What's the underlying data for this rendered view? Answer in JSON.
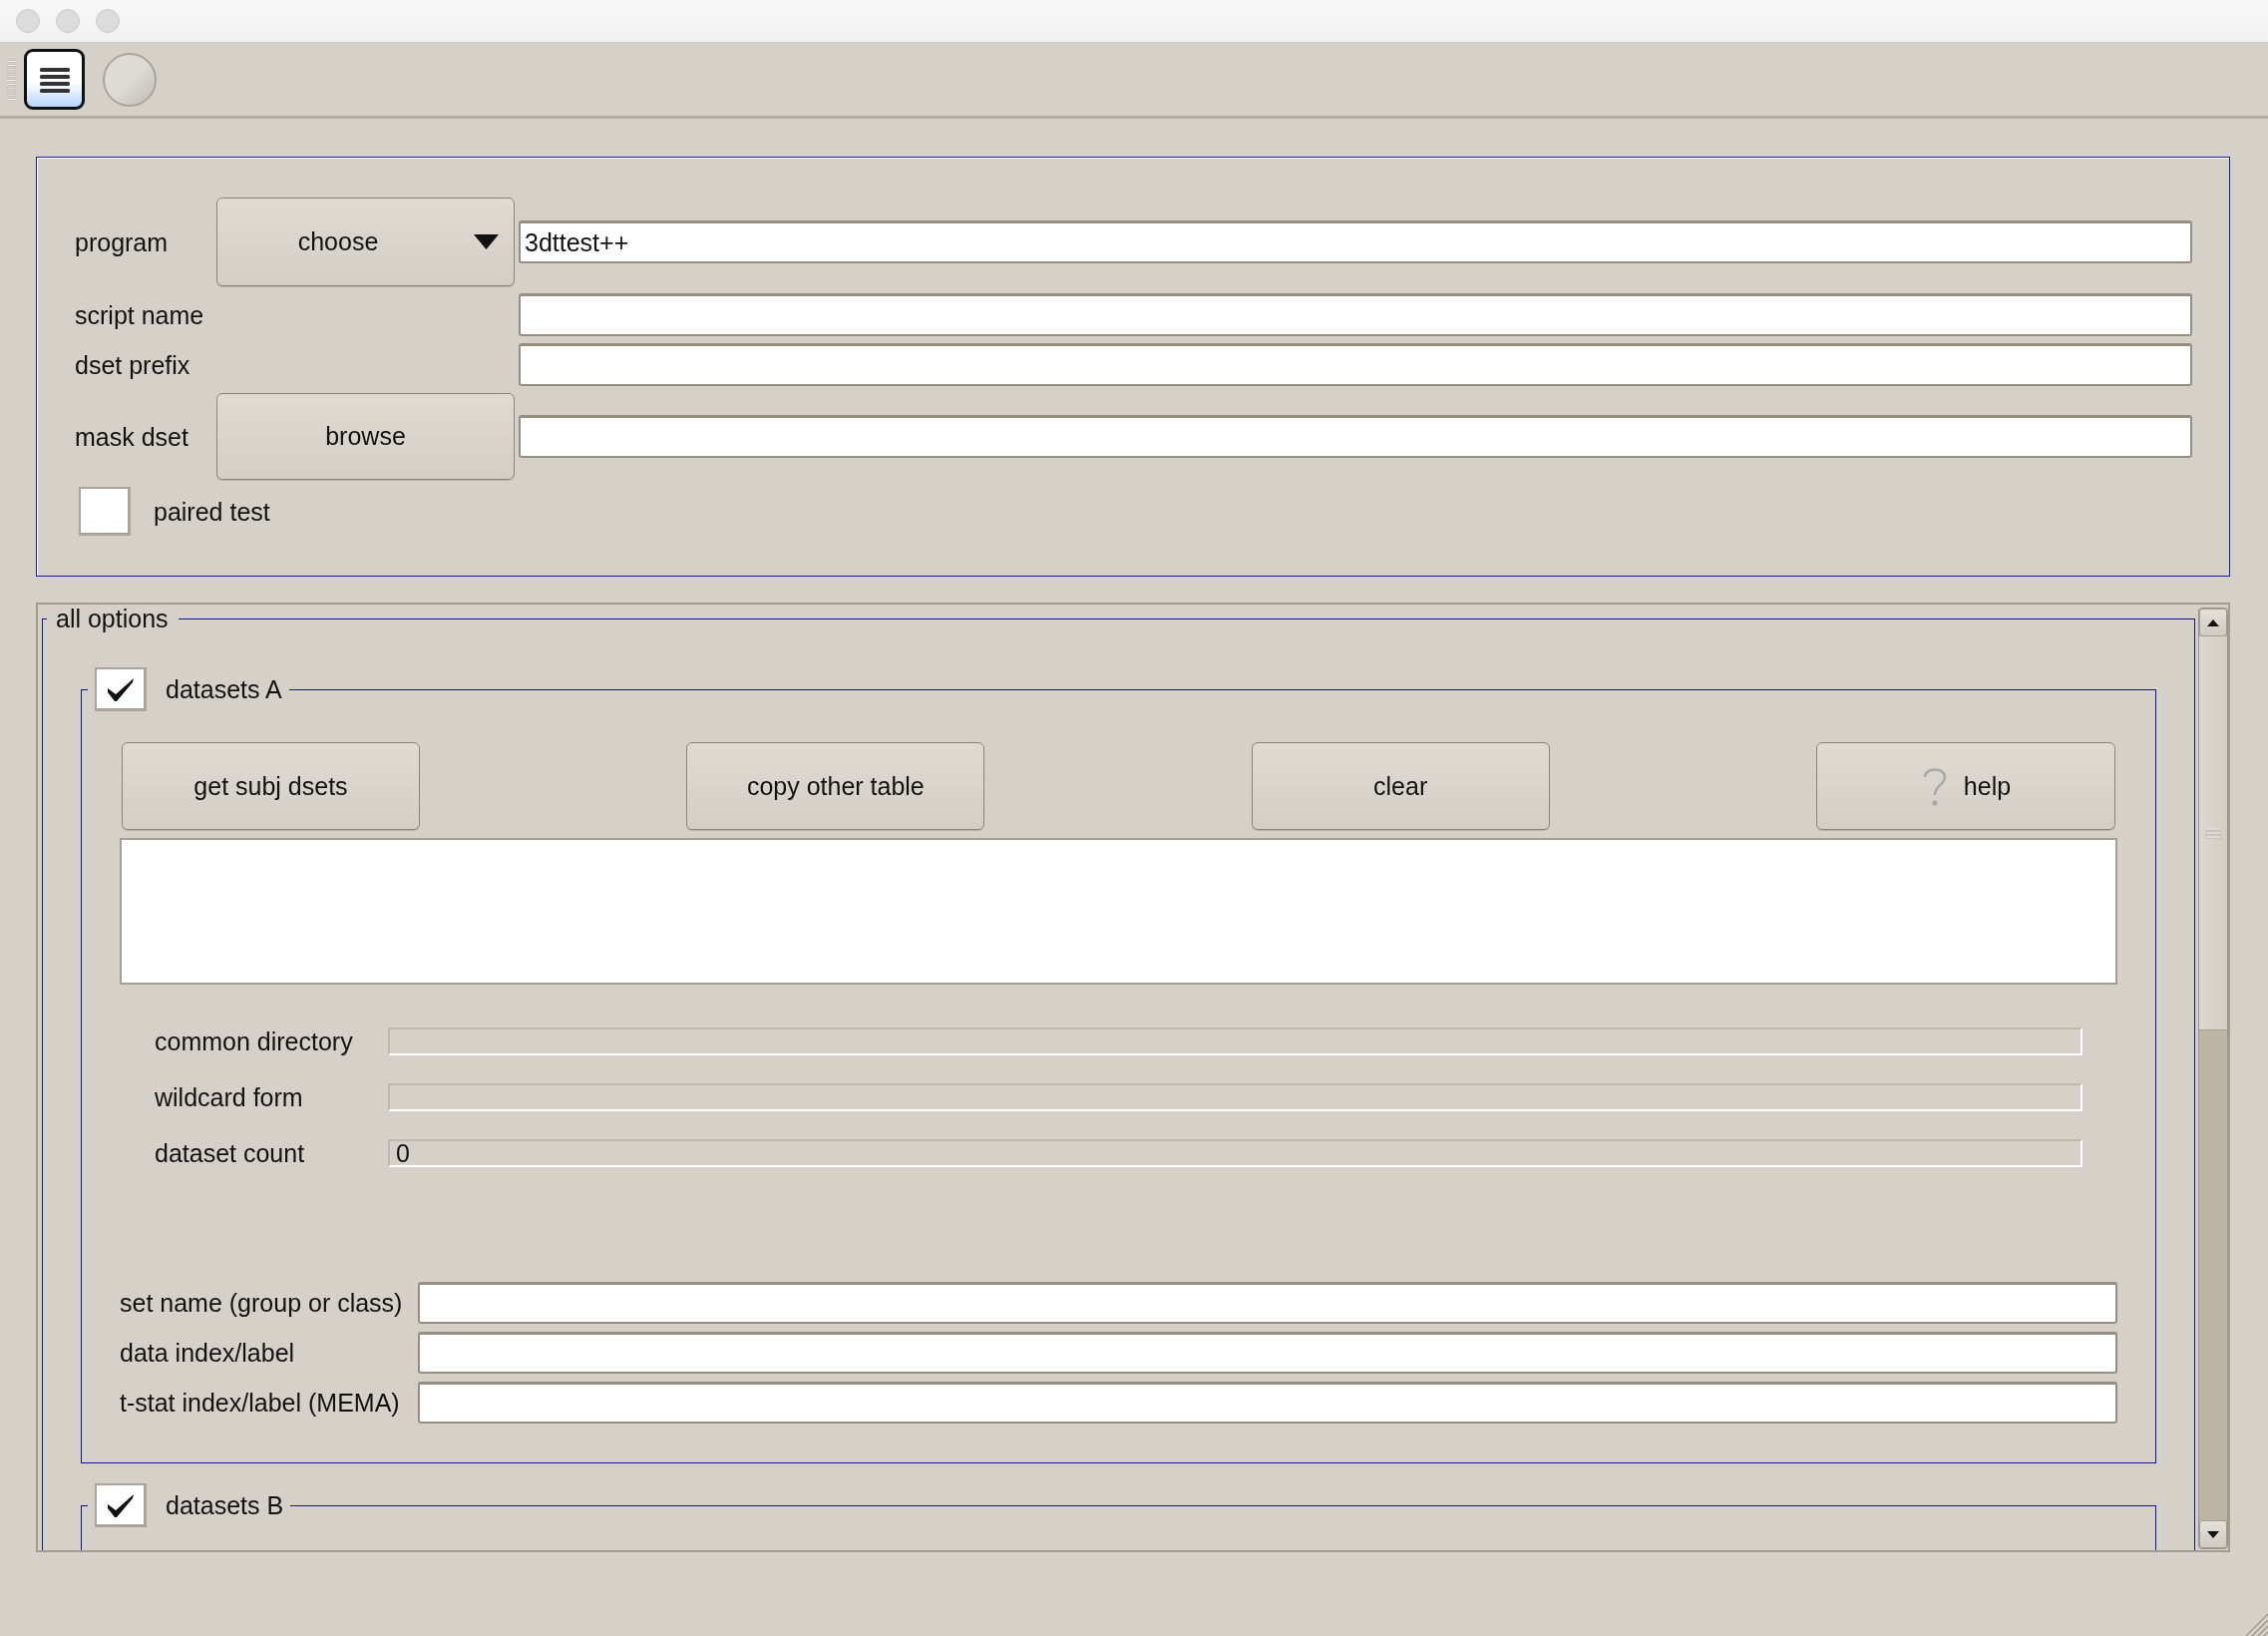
{
  "toolbar": {
    "buttons": [
      {
        "kind": "menu",
        "selected": true
      },
      {
        "kind": "round",
        "selected": false
      }
    ]
  },
  "settings": {
    "fields": [
      {
        "kind": "menu",
        "label": "program",
        "button": "choose",
        "value": "3dttest++"
      },
      {
        "kind": "text",
        "label": "script name"
      },
      {
        "kind": "text",
        "label": "dset prefix"
      },
      {
        "kind": "browse",
        "label": "mask dset",
        "button": "browse"
      }
    ],
    "paired_test": {
      "label": "paired test",
      "checked": false
    }
  },
  "all_options": {
    "title": "all options",
    "groups": [
      {
        "title": "datasets A",
        "checked": true,
        "buttons": [
          {
            "kind": "plain",
            "label": "get subj dsets"
          },
          {
            "kind": "plain",
            "label": "copy other table"
          },
          {
            "kind": "plain",
            "label": "clear"
          },
          {
            "kind": "help",
            "label": "help"
          }
        ],
        "info": [
          {
            "label": "common directory"
          },
          {
            "label": "wildcard form"
          },
          {
            "label": "dataset count",
            "value": "0"
          }
        ],
        "entries": [
          {
            "label": "set name (group or class)"
          },
          {
            "label": "data index/label"
          },
          {
            "label": "t-stat index/label (MEMA)"
          }
        ]
      },
      {
        "title": "datasets B",
        "checked": true
      }
    ]
  }
}
